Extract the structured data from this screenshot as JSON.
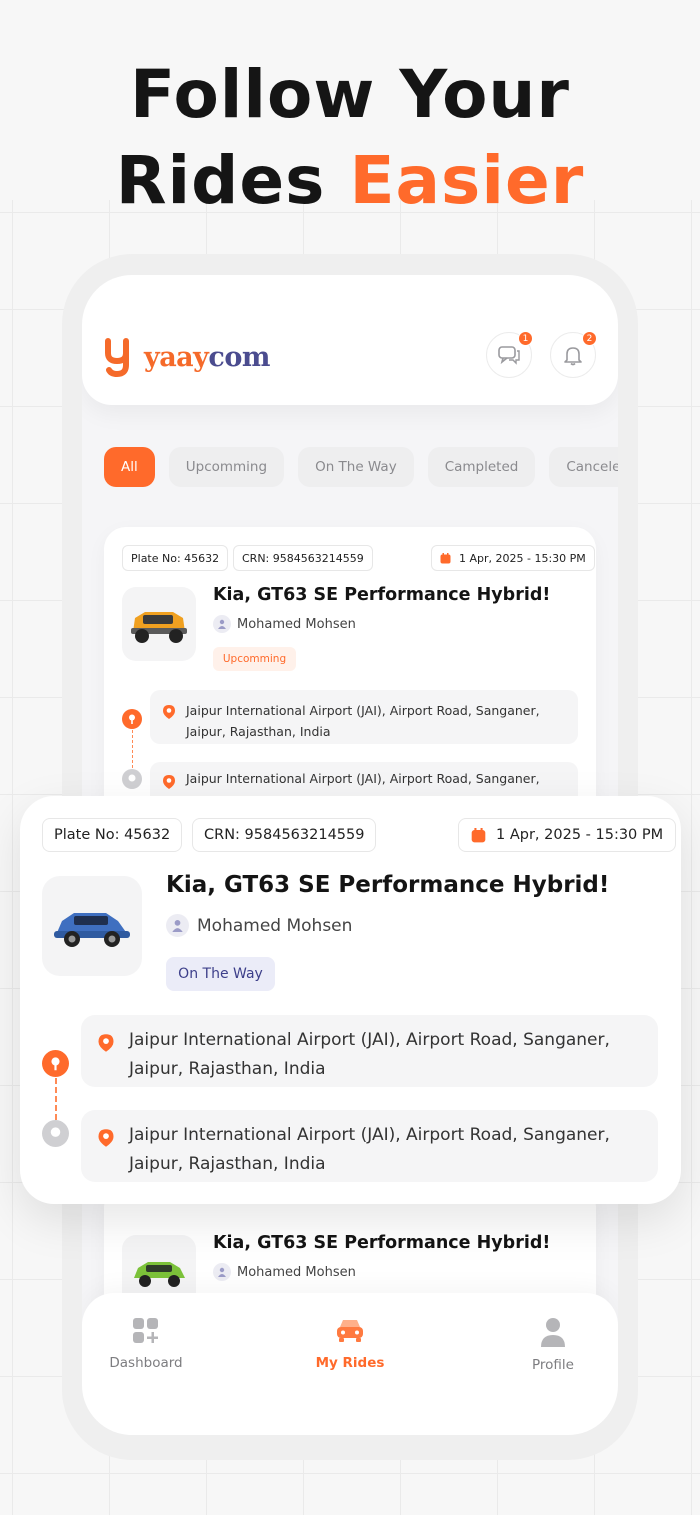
{
  "headline": {
    "line1": "Follow Your",
    "line2_prefix": "Rides ",
    "line2_accent": "Easier"
  },
  "app": {
    "logo_text_prefix": "yaay",
    "logo_text_suffix": "com",
    "chat_badge": "1",
    "notification_badge": "2"
  },
  "tabs": [
    "All",
    "Upcomming",
    "On The Way",
    "Campleted",
    "Canceled"
  ],
  "active_tab": "All",
  "rides": [
    {
      "plate": "Plate No: 45632",
      "crn": "CRN: 9584563214559",
      "date": "1 Apr, 2025 - 15:30 PM",
      "title": "Kia, GT63 SE Performance Hybrid!",
      "driver": "Mohamed Mohsen",
      "status": "Upcomming",
      "car_color": "#f0a020",
      "pickup": "Jaipur International Airport (JAI), Airport Road, Sanganer, Jaipur, Rajasthan, India",
      "dropoff": "Jaipur International Airport (JAI), Airport Road, Sanganer,"
    },
    {
      "plate": "Plate No: 45632",
      "crn": "CRN: 9584563214559",
      "date": "1 Apr, 2025 - 15:30 PM",
      "title": "Kia, GT63 SE Performance Hybrid!",
      "driver": "Mohamed Mohsen",
      "status": "On The Way",
      "car_color": "#3f6fc0",
      "pickup": "Jaipur International Airport (JAI), Airport Road, Sanganer, Jaipur, Rajasthan, India",
      "dropoff": "Jaipur International Airport (JAI), Airport Road, Sanganer, Jaipur, Rajasthan, India"
    },
    {
      "title": "Kia, GT63 SE Performance Hybrid!",
      "driver": "Mohamed Mohsen",
      "car_color": "#7cc23a"
    }
  ],
  "nav": {
    "dashboard": "Dashboard",
    "my_rides": "My Rides",
    "profile": "Profile"
  },
  "colors": {
    "accent": "#ff6a2b",
    "brand_blue": "#4b4c8f",
    "on_the_way_bg": "#ebecf8",
    "upcoming_bg": "#fff1ea"
  }
}
